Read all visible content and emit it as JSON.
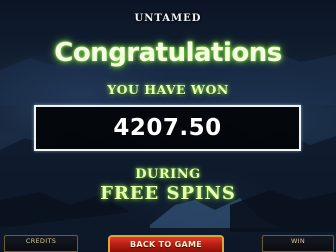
{
  "logo": {
    "text": "UNTAMED"
  },
  "popup": {
    "headline": "Congratulations",
    "won_label": "YOU HAVE WON",
    "amount": "4207.50",
    "during_label": "DURING",
    "feature_label": "FREE SPINS"
  },
  "bottom_bar": {
    "credits_label": "CREDITS",
    "credits_value": "",
    "back_button_label": "BACK TO GAME",
    "win_label": "WIN",
    "win_value": ""
  },
  "colors": {
    "headline_glow": "#7ec840",
    "button_red": "#c8261a",
    "button_border": "#d9a63a"
  }
}
